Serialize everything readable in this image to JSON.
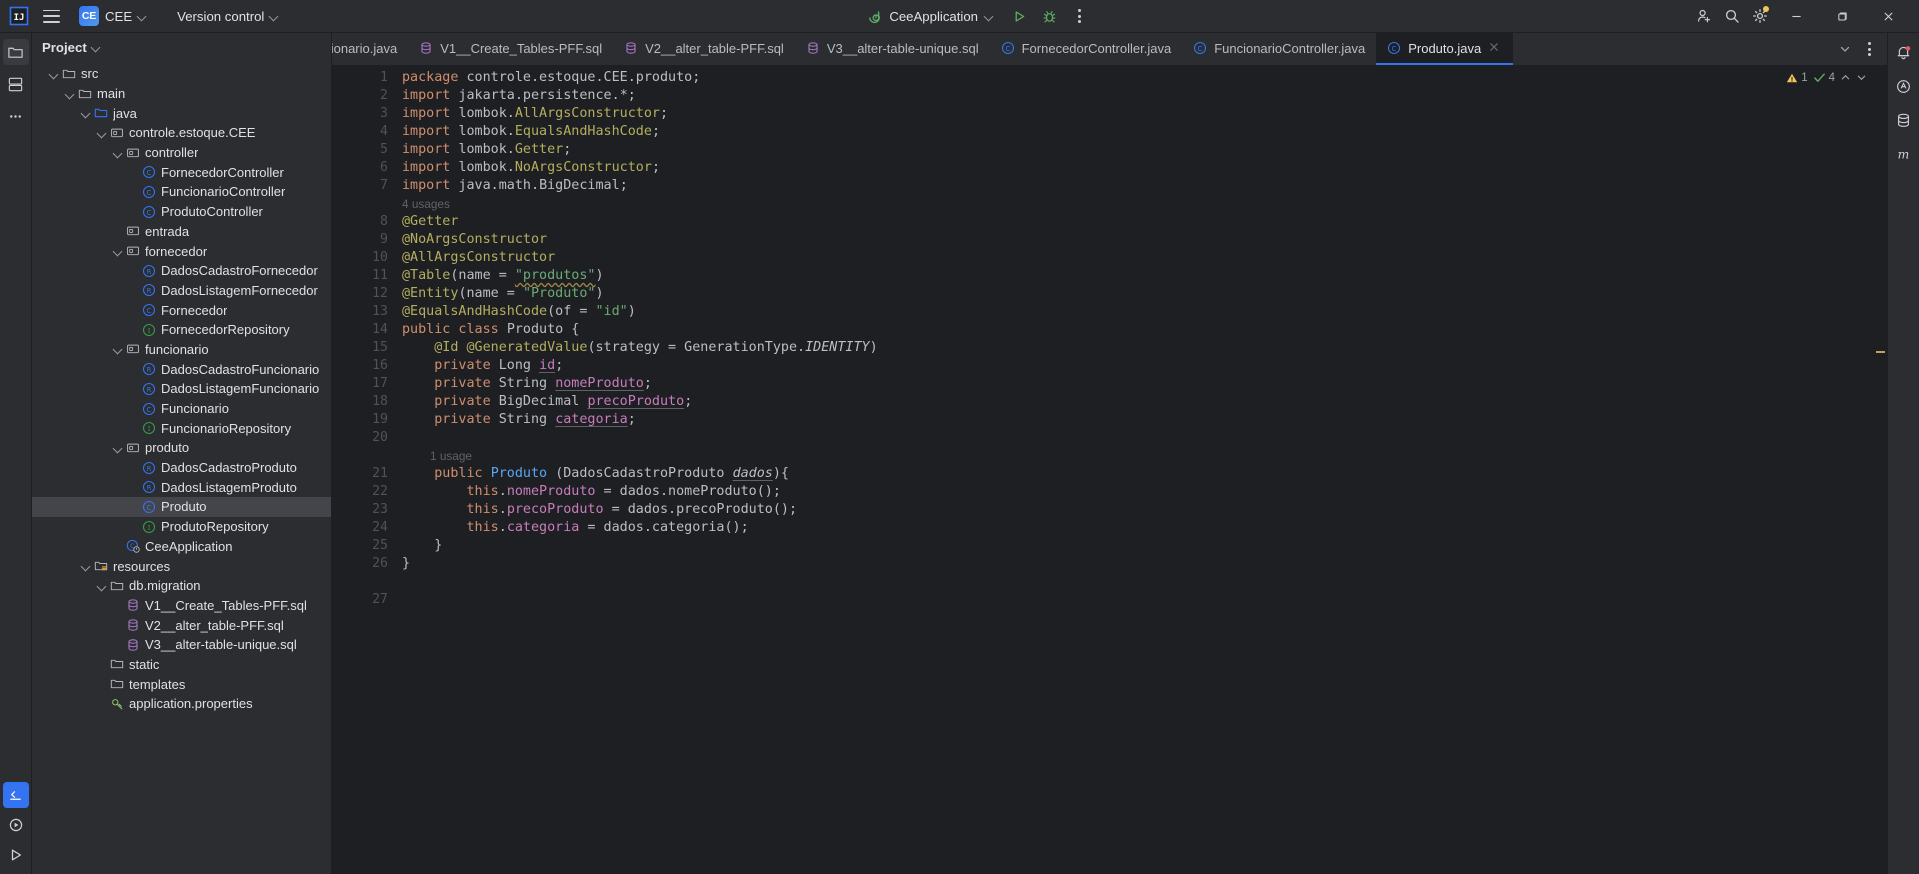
{
  "toolbar": {
    "app_logo": "intellij-idea-logo",
    "menu_icon": "hamburger-menu-icon",
    "project_badge": "CE",
    "project_name": "CEE",
    "version_control": "Version control",
    "run_config": "CeeApplication",
    "run_icon": "run-icon",
    "debug_icon": "debug-icon",
    "more_icon": "more-actions-icon",
    "add_user_icon": "add-user-icon",
    "search_icon": "search-icon",
    "settings_icon": "gear-icon",
    "minimize": "minimize-icon",
    "maximize": "maximize-icon",
    "close": "close-icon"
  },
  "left_rail": {
    "items": [
      {
        "name": "project-tool-window",
        "icon": "folder-icon",
        "active": true
      },
      {
        "name": "commit-tool-window",
        "icon": "commit-icon",
        "active": false
      },
      {
        "name": "more-tool-windows",
        "icon": "ellipsis-icon",
        "active": false
      }
    ],
    "bottom": [
      {
        "name": "terminal-tool-window",
        "icon": "terminal-icon"
      },
      {
        "name": "services-tool-window",
        "icon": "services-play-icon"
      },
      {
        "name": "run-tool-window",
        "icon": "run-play-icon"
      }
    ]
  },
  "right_rail": {
    "items": [
      {
        "name": "notifications",
        "icon": "bell-icon",
        "badge": true
      },
      {
        "name": "ai-assistant",
        "icon": "ai-icon"
      },
      {
        "name": "database",
        "icon": "database-icon"
      },
      {
        "name": "maven",
        "icon": "maven-m-icon"
      }
    ]
  },
  "project_panel": {
    "title": "Project",
    "tree": [
      {
        "depth": 1,
        "label": "src",
        "icon": "folder",
        "arrow": "open"
      },
      {
        "depth": 2,
        "label": "main",
        "icon": "folder",
        "arrow": "open"
      },
      {
        "depth": 3,
        "label": "java",
        "icon": "folder-source",
        "arrow": "open"
      },
      {
        "depth": 4,
        "label": "controle.estoque.CEE",
        "icon": "package",
        "arrow": "open"
      },
      {
        "depth": 5,
        "label": "controller",
        "icon": "package",
        "arrow": "open"
      },
      {
        "depth": 6,
        "label": "FornecedorController",
        "icon": "class",
        "arrow": "none"
      },
      {
        "depth": 6,
        "label": "FuncionarioController",
        "icon": "class",
        "arrow": "none"
      },
      {
        "depth": 6,
        "label": "ProdutoController",
        "icon": "class",
        "arrow": "none"
      },
      {
        "depth": 5,
        "label": "entrada",
        "icon": "package",
        "arrow": "none"
      },
      {
        "depth": 5,
        "label": "fornecedor",
        "icon": "package",
        "arrow": "open"
      },
      {
        "depth": 6,
        "label": "DadosCadastroFornecedor",
        "icon": "record",
        "arrow": "none"
      },
      {
        "depth": 6,
        "label": "DadosListagemFornecedor",
        "icon": "record",
        "arrow": "none"
      },
      {
        "depth": 6,
        "label": "Fornecedor",
        "icon": "class",
        "arrow": "none"
      },
      {
        "depth": 6,
        "label": "FornecedorRepository",
        "icon": "interface",
        "arrow": "none"
      },
      {
        "depth": 5,
        "label": "funcionario",
        "icon": "package",
        "arrow": "open"
      },
      {
        "depth": 6,
        "label": "DadosCadastroFuncionario",
        "icon": "record",
        "arrow": "none"
      },
      {
        "depth": 6,
        "label": "DadosListagemFuncionario",
        "icon": "record",
        "arrow": "none"
      },
      {
        "depth": 6,
        "label": "Funcionario",
        "icon": "class",
        "arrow": "none"
      },
      {
        "depth": 6,
        "label": "FuncionarioRepository",
        "icon": "interface",
        "arrow": "none"
      },
      {
        "depth": 5,
        "label": "produto",
        "icon": "package",
        "arrow": "open"
      },
      {
        "depth": 6,
        "label": "DadosCadastroProduto",
        "icon": "record",
        "arrow": "none"
      },
      {
        "depth": 6,
        "label": "DadosListagemProduto",
        "icon": "record",
        "arrow": "none"
      },
      {
        "depth": 6,
        "label": "Produto",
        "icon": "class",
        "arrow": "none",
        "selected": true
      },
      {
        "depth": 6,
        "label": "ProdutoRepository",
        "icon": "interface",
        "arrow": "none"
      },
      {
        "depth": 5,
        "label": "CeeApplication",
        "icon": "class-run",
        "arrow": "none"
      },
      {
        "depth": 3,
        "label": "resources",
        "icon": "folder-resource",
        "arrow": "open"
      },
      {
        "depth": 4,
        "label": "db.migration",
        "icon": "folder",
        "arrow": "open"
      },
      {
        "depth": 5,
        "label": "V1__Create_Tables-PFF.sql",
        "icon": "sql",
        "arrow": "none"
      },
      {
        "depth": 5,
        "label": "V2__alter_table-PFF.sql",
        "icon": "sql",
        "arrow": "none"
      },
      {
        "depth": 5,
        "label": "V3__alter-table-unique.sql",
        "icon": "sql",
        "arrow": "none"
      },
      {
        "depth": 4,
        "label": "static",
        "icon": "folder",
        "arrow": "none"
      },
      {
        "depth": 4,
        "label": "templates",
        "icon": "folder",
        "arrow": "none"
      },
      {
        "depth": 4,
        "label": "application.properties",
        "icon": "properties",
        "arrow": "none"
      }
    ]
  },
  "editor_tabs": [
    {
      "label": "mFuncionario.java",
      "icon": "record",
      "active": false,
      "truncated_left": true
    },
    {
      "label": "V1__Create_Tables-PFF.sql",
      "icon": "sql",
      "active": false
    },
    {
      "label": "V2__alter_table-PFF.sql",
      "icon": "sql",
      "active": false
    },
    {
      "label": "V3__alter-table-unique.sql",
      "icon": "sql",
      "active": false
    },
    {
      "label": "FornecedorController.java",
      "icon": "class",
      "active": false
    },
    {
      "label": "FuncionarioController.java",
      "icon": "class",
      "active": false
    },
    {
      "label": "Produto.java",
      "icon": "class",
      "active": true,
      "closable": true
    }
  ],
  "tabbar_actions": {
    "chevron": "chevron-down-icon",
    "kebab": "more-options-icon"
  },
  "inspections": {
    "warning_icon": "warning-triangle-icon",
    "warning_count": "1",
    "ok_icon": "checkmark-icon",
    "ok_count": "4",
    "up_icon": "chevron-up-icon",
    "down_icon": "chevron-down-icon"
  },
  "code": {
    "language": "java",
    "lines": [
      {
        "n": "1",
        "tokens": [
          {
            "t": "package ",
            "c": "kw"
          },
          {
            "t": "controle.estoque.CEE.produto;",
            "c": "pl"
          }
        ]
      },
      {
        "n": "2",
        "tokens": [
          {
            "t": "import ",
            "c": "kw"
          },
          {
            "t": "jakarta.persistence.",
            "c": "pl"
          },
          {
            "t": "*",
            "c": "pl"
          },
          {
            "t": ";",
            "c": "pl"
          }
        ]
      },
      {
        "n": "3",
        "tokens": [
          {
            "t": "import ",
            "c": "kw"
          },
          {
            "t": "lombok.",
            "c": "pl"
          },
          {
            "t": "AllArgsConstructor",
            "c": "ann"
          },
          {
            "t": ";",
            "c": "pl"
          }
        ]
      },
      {
        "n": "4",
        "tokens": [
          {
            "t": "import ",
            "c": "kw"
          },
          {
            "t": "lombok.",
            "c": "pl"
          },
          {
            "t": "EqualsAndHashCode",
            "c": "ann"
          },
          {
            "t": ";",
            "c": "pl"
          }
        ]
      },
      {
        "n": "5",
        "tokens": [
          {
            "t": "import ",
            "c": "kw"
          },
          {
            "t": "lombok.",
            "c": "pl"
          },
          {
            "t": "Getter",
            "c": "ann"
          },
          {
            "t": ";",
            "c": "pl"
          }
        ]
      },
      {
        "n": "6",
        "tokens": [
          {
            "t": "import ",
            "c": "kw"
          },
          {
            "t": "lombok.",
            "c": "pl"
          },
          {
            "t": "NoArgsConstructor",
            "c": "ann"
          },
          {
            "t": ";",
            "c": "pl"
          }
        ]
      },
      {
        "n": "7",
        "tokens": [
          {
            "t": "import ",
            "c": "kw"
          },
          {
            "t": "java.math.",
            "c": "pl"
          },
          {
            "t": "BigDecimal",
            "c": "pl"
          },
          {
            "t": ";",
            "c": "pl"
          }
        ]
      },
      {
        "n": "",
        "hint": "4 usages"
      },
      {
        "n": "8",
        "tokens": [
          {
            "t": "@Getter",
            "c": "ann"
          }
        ]
      },
      {
        "n": "9",
        "tokens": [
          {
            "t": "@NoArgsConstructor",
            "c": "ann"
          }
        ]
      },
      {
        "n": "10",
        "tokens": [
          {
            "t": "@AllArgsConstructor",
            "c": "ann"
          }
        ]
      },
      {
        "n": "11",
        "tokens": [
          {
            "t": "@Table",
            "c": "ann"
          },
          {
            "t": "(name = ",
            "c": "pl"
          },
          {
            "t": "\"produtos\"",
            "c": "str wavy"
          },
          {
            "t": ")",
            "c": "pl"
          }
        ]
      },
      {
        "n": "12",
        "tokens": [
          {
            "t": "@Entity",
            "c": "ann"
          },
          {
            "t": "(name = ",
            "c": "pl"
          },
          {
            "t": "\"Produto\"",
            "c": "str"
          },
          {
            "t": ")",
            "c": "pl"
          }
        ]
      },
      {
        "n": "13",
        "tokens": [
          {
            "t": "@EqualsAndHashCode",
            "c": "ann"
          },
          {
            "t": "(of = ",
            "c": "pl"
          },
          {
            "t": "\"id\"",
            "c": "str"
          },
          {
            "t": ")",
            "c": "pl"
          }
        ]
      },
      {
        "n": "14",
        "gmark": "entity-table-icon",
        "tokens": [
          {
            "t": "public class ",
            "c": "kw"
          },
          {
            "t": "Produto",
            "c": "cls"
          },
          {
            "t": " {",
            "c": "pl"
          }
        ]
      },
      {
        "n": "15",
        "tokens": [
          {
            "t": "    ",
            "c": "pl"
          },
          {
            "t": "@Id @GeneratedValue",
            "c": "ann"
          },
          {
            "t": "(strategy = GenerationType.",
            "c": "pl"
          },
          {
            "t": "IDENTITY",
            "c": "static-it"
          },
          {
            "t": ")",
            "c": "pl"
          }
        ]
      },
      {
        "n": "16",
        "gmark": "getter-icon",
        "tokens": [
          {
            "t": "    ",
            "c": "pl"
          },
          {
            "t": "private ",
            "c": "kw"
          },
          {
            "t": "Long ",
            "c": "pl"
          },
          {
            "t": "id",
            "c": "fld usedecl"
          },
          {
            "t": ";",
            "c": "pl"
          }
        ]
      },
      {
        "n": "17",
        "gmark": "getter-icon",
        "tokens": [
          {
            "t": "    ",
            "c": "pl"
          },
          {
            "t": "private ",
            "c": "kw"
          },
          {
            "t": "String ",
            "c": "pl"
          },
          {
            "t": "nomeProduto",
            "c": "fld usedecl"
          },
          {
            "t": ";",
            "c": "pl"
          }
        ]
      },
      {
        "n": "18",
        "gmark": "getter-icon",
        "tokens": [
          {
            "t": "    ",
            "c": "pl"
          },
          {
            "t": "private ",
            "c": "kw"
          },
          {
            "t": "BigDecimal ",
            "c": "pl"
          },
          {
            "t": "precoProduto",
            "c": "fld usedecl"
          },
          {
            "t": ";",
            "c": "pl"
          }
        ]
      },
      {
        "n": "19",
        "gmark": "getter-icon",
        "tokens": [
          {
            "t": "    ",
            "c": "pl"
          },
          {
            "t": "private ",
            "c": "kw"
          },
          {
            "t": "String ",
            "c": "pl"
          },
          {
            "t": "categoria",
            "c": "fld usedecl"
          },
          {
            "t": ";",
            "c": "pl"
          }
        ]
      },
      {
        "n": "20",
        "tokens": []
      },
      {
        "n": "",
        "hint": "1 usage",
        "hint_indent": true
      },
      {
        "n": "21",
        "gmark": "annotation-at-icon",
        "tokens": [
          {
            "t": "    ",
            "c": "pl"
          },
          {
            "t": "public ",
            "c": "kw"
          },
          {
            "t": "Produto ",
            "c": "ident-blue"
          },
          {
            "t": "(DadosCadastroProduto ",
            "c": "pl"
          },
          {
            "t": "dados",
            "c": "param-it usedecl"
          },
          {
            "t": "){",
            "c": "pl"
          }
        ]
      },
      {
        "n": "22",
        "tokens": [
          {
            "t": "        ",
            "c": "pl"
          },
          {
            "t": "this",
            "c": "kw"
          },
          {
            "t": ".",
            "c": "pl"
          },
          {
            "t": "nomeProduto",
            "c": "fld"
          },
          {
            "t": " = dados.nomeProduto();",
            "c": "pl"
          }
        ]
      },
      {
        "n": "23",
        "tokens": [
          {
            "t": "        ",
            "c": "pl"
          },
          {
            "t": "this",
            "c": "kw"
          },
          {
            "t": ".",
            "c": "pl"
          },
          {
            "t": "precoProduto",
            "c": "fld"
          },
          {
            "t": " = dados.precoProduto();",
            "c": "pl"
          }
        ]
      },
      {
        "n": "24",
        "tokens": [
          {
            "t": "        ",
            "c": "pl"
          },
          {
            "t": "this",
            "c": "kw"
          },
          {
            "t": ".",
            "c": "pl"
          },
          {
            "t": "categoria",
            "c": "fld"
          },
          {
            "t": " = dados.categoria();",
            "c": "pl"
          }
        ]
      },
      {
        "n": "25",
        "tokens": [
          {
            "t": "    }",
            "c": "pl"
          }
        ]
      },
      {
        "n": "26",
        "tokens": [
          {
            "t": "}",
            "c": "pl"
          }
        ]
      },
      {
        "n": "",
        "tokens": []
      },
      {
        "n": "27",
        "tokens": []
      }
    ]
  },
  "colors": {
    "accent": "#3574f0",
    "toolbar_bg": "#2b2d30",
    "editor_bg": "#1e1f22",
    "selection": "#43454a",
    "keyword": "#cf8e6d",
    "annotation": "#b3ae60",
    "string": "#6aab73",
    "field": "#c77dbb",
    "class_icon": "#3574f0",
    "interface_icon": "#389c48",
    "sql_icon": "#a97bc7",
    "warning": "#f2c55c",
    "run_green": "#5fad65"
  }
}
